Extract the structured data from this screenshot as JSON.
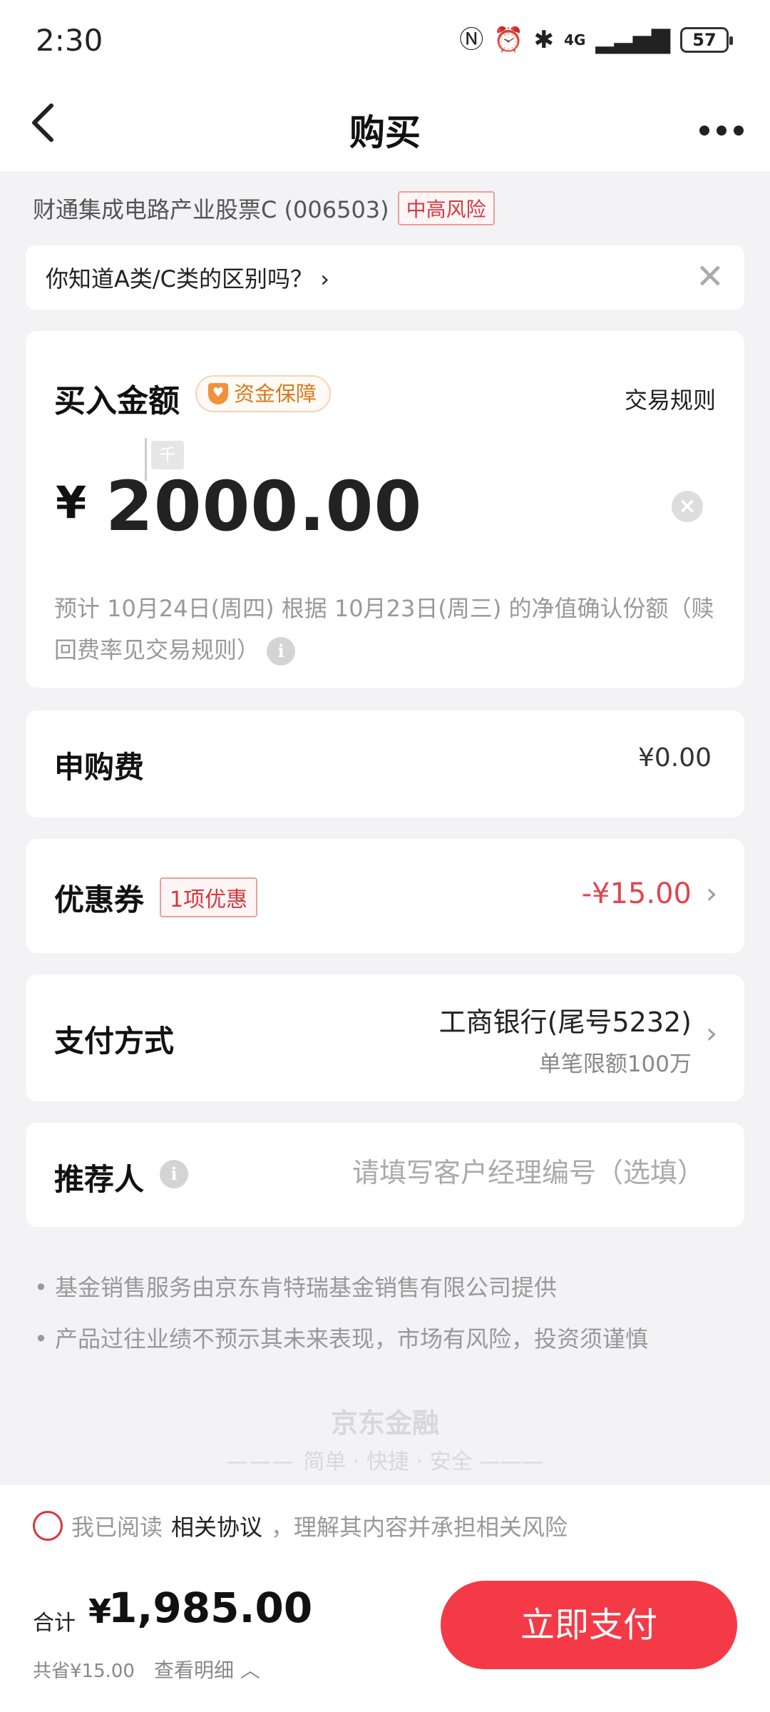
{
  "status_bar": {
    "time": "2:30",
    "network": "4G",
    "battery": "57"
  },
  "nav": {
    "title": "购买"
  },
  "fund": {
    "name": "财通集成电路产业股票C (006503)",
    "risk": "中高风险"
  },
  "tip": {
    "text": "你知道A类/C类的区别吗？ ›"
  },
  "amount": {
    "label": "买入金额",
    "guarantee": "资金保障",
    "rules_link": "交易规则",
    "unit_hint": "千",
    "currency": "¥",
    "value": "2000.00",
    "confirm_text": "预计 10月24日(周四) 根据 10月23日(周三) 的净值确认份额（赎回费率见交易规则）"
  },
  "fee": {
    "label": "申购费",
    "value": "¥0.00"
  },
  "coupon": {
    "label": "优惠券",
    "badge": "1项优惠",
    "value": "-¥15.00"
  },
  "payment": {
    "label": "支付方式",
    "bank": "工商银行(尾号5232)",
    "limit": "单笔限额100万"
  },
  "referrer": {
    "label": "推荐人",
    "placeholder": "请填写客户经理编号（选填）"
  },
  "disclaimers": [
    "• 基金销售服务由京东肯特瑞基金销售有限公司提供",
    "• 产品过往业绩不预示其未来表现，市场有风险，投资须谨慎"
  ],
  "brand": {
    "name": "京东金融",
    "slogan": "简单 · 快捷 · 安全"
  },
  "agreement": {
    "prefix": "我已阅读",
    "link": "相关协议",
    "suffix": "，理解其内容并承担相关风险"
  },
  "total": {
    "label": "合计",
    "currency": "¥",
    "value": "1,985.00",
    "saved": "共省¥15.00",
    "detail": "查看明细 ︿"
  },
  "pay_button": "立即支付"
}
